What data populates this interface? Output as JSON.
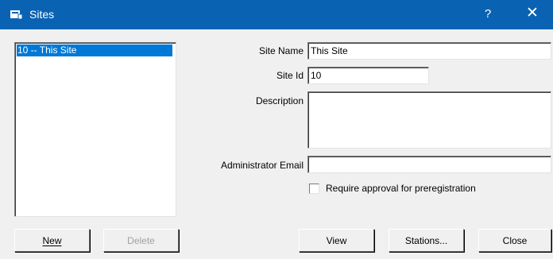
{
  "window": {
    "title": "Sites",
    "help_glyph": "?",
    "close_glyph": "✕"
  },
  "site_list": {
    "items": [
      {
        "label": "10 -- This Site",
        "selected": true
      }
    ]
  },
  "form": {
    "site_name_label": "Site Name",
    "site_name_value": "This Site",
    "site_id_label": "Site Id",
    "site_id_value": "10",
    "description_label": "Description",
    "description_value": "",
    "admin_email_label": "Administrator Email",
    "admin_email_value": "",
    "require_approval_label": "Require approval for preregistration",
    "require_approval_checked": false
  },
  "buttons": {
    "new": "New",
    "delete": "Delete",
    "view": "View",
    "stations": "Stations...",
    "close": "Close"
  },
  "colors": {
    "titlebar": "#0a62b3",
    "selection": "#0078d7",
    "dialog_bg": "#f0f0f0"
  }
}
